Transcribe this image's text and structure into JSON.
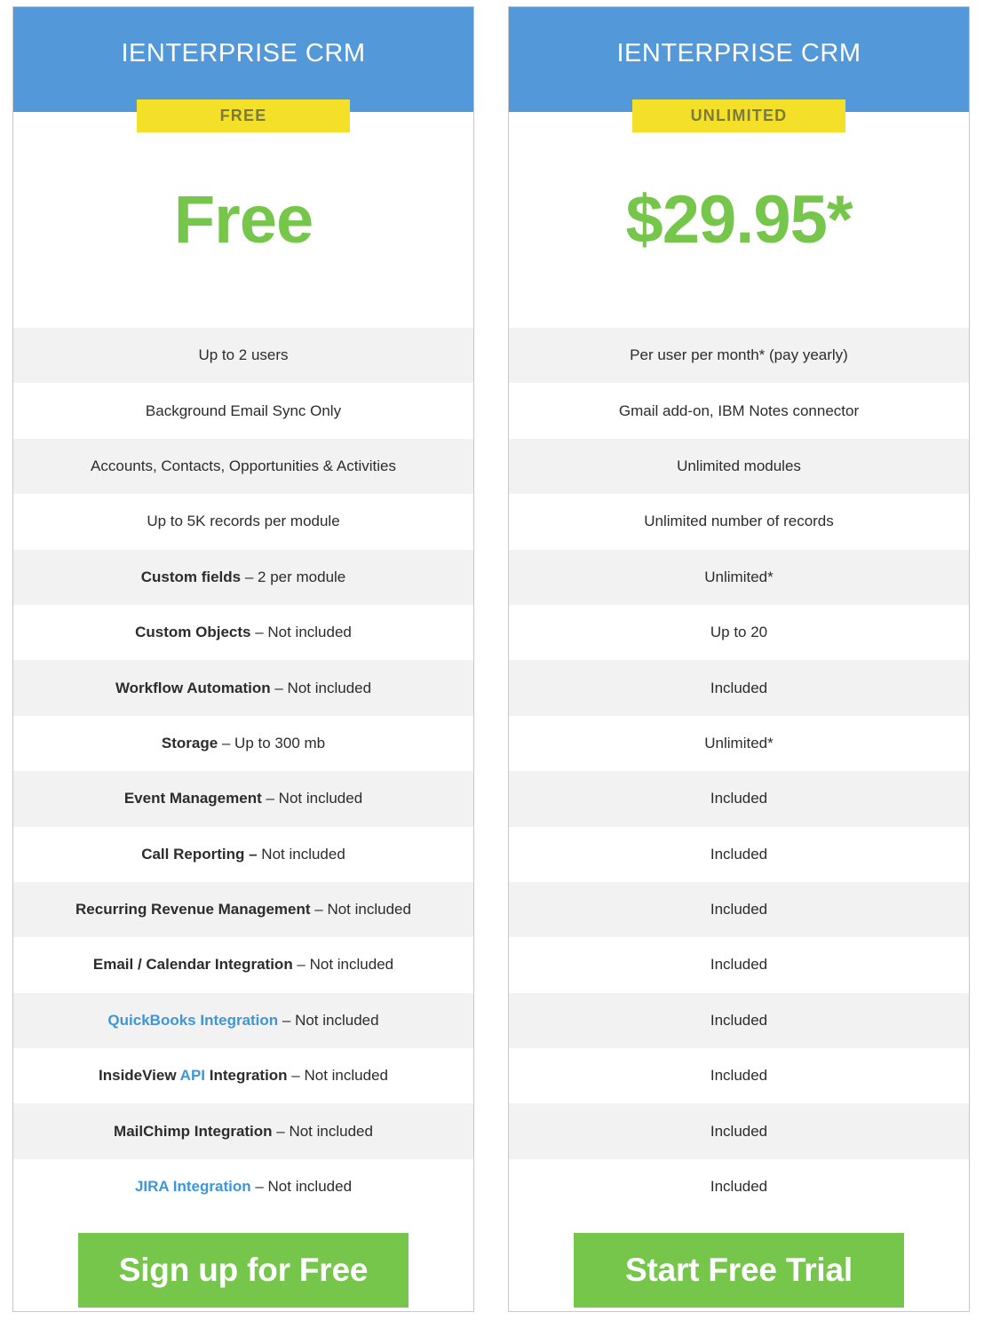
{
  "plans": [
    {
      "id": "free",
      "title": "IENTERPRISE CRM",
      "badge": "FREE",
      "price": "Free",
      "cta": "Sign up for Free",
      "features": [
        {
          "parts": [
            {
              "text": "Up to 2 users",
              "style": "plain"
            }
          ]
        },
        {
          "parts": [
            {
              "text": "Background Email Sync Only",
              "style": "plain"
            }
          ]
        },
        {
          "parts": [
            {
              "text": "Accounts, Contacts, Opportunities & Activities",
              "style": "plain"
            }
          ]
        },
        {
          "parts": [
            {
              "text": "Up to 5K records per module",
              "style": "plain"
            }
          ]
        },
        {
          "parts": [
            {
              "text": "Custom fields",
              "style": "bold"
            },
            {
              "text": " – 2 per module",
              "style": "plain"
            }
          ]
        },
        {
          "parts": [
            {
              "text": "Custom Objects",
              "style": "bold"
            },
            {
              "text": " – Not included",
              "style": "plain"
            }
          ]
        },
        {
          "parts": [
            {
              "text": "Workflow Automation",
              "style": "bold"
            },
            {
              "text": " – Not included",
              "style": "plain"
            }
          ]
        },
        {
          "parts": [
            {
              "text": "Storage",
              "style": "bold"
            },
            {
              "text": " – Up to 300 mb",
              "style": "plain"
            }
          ]
        },
        {
          "parts": [
            {
              "text": "Event Management",
              "style": "bold"
            },
            {
              "text": " – Not included",
              "style": "plain"
            }
          ]
        },
        {
          "parts": [
            {
              "text": "Call Reporting –",
              "style": "bold"
            },
            {
              "text": " Not included",
              "style": "plain"
            }
          ]
        },
        {
          "parts": [
            {
              "text": "Recurring Revenue Management",
              "style": "bold"
            },
            {
              "text": " – Not included",
              "style": "plain"
            }
          ]
        },
        {
          "parts": [
            {
              "text": "Email / Calendar Integration",
              "style": "bold"
            },
            {
              "text": " – Not included",
              "style": "plain"
            }
          ]
        },
        {
          "parts": [
            {
              "text": "QuickBooks Integration",
              "style": "link"
            },
            {
              "text": " – Not included",
              "style": "plain"
            }
          ]
        },
        {
          "parts": [
            {
              "text": "InsideView ",
              "style": "bold"
            },
            {
              "text": "API",
              "style": "link"
            },
            {
              "text": " Integration",
              "style": "bold"
            },
            {
              "text": " – Not included",
              "style": "plain"
            }
          ]
        },
        {
          "parts": [
            {
              "text": "MailChimp Integration",
              "style": "bold"
            },
            {
              "text": " – Not included",
              "style": "plain"
            }
          ]
        },
        {
          "parts": [
            {
              "text": "JIRA Integration",
              "style": "link"
            },
            {
              "text": " – Not included",
              "style": "plain"
            }
          ]
        }
      ]
    },
    {
      "id": "unlimited",
      "title": "IENTERPRISE CRM",
      "badge": "UNLIMITED",
      "price": "$29.95*",
      "cta": "Start Free Trial",
      "features": [
        {
          "parts": [
            {
              "text": "Per user per month* (pay yearly)",
              "style": "plain"
            }
          ]
        },
        {
          "parts": [
            {
              "text": "Gmail  add-on, IBM Notes connector",
              "style": "plain"
            }
          ]
        },
        {
          "parts": [
            {
              "text": "Unlimited modules",
              "style": "plain"
            }
          ]
        },
        {
          "parts": [
            {
              "text": "Unlimited number of records",
              "style": "plain"
            }
          ]
        },
        {
          "parts": [
            {
              "text": "Unlimited*",
              "style": "plain"
            }
          ]
        },
        {
          "parts": [
            {
              "text": "Up to 20",
              "style": "plain"
            }
          ]
        },
        {
          "parts": [
            {
              "text": "Included",
              "style": "plain"
            }
          ]
        },
        {
          "parts": [
            {
              "text": "Unlimited*",
              "style": "plain"
            }
          ]
        },
        {
          "parts": [
            {
              "text": "Included",
              "style": "plain"
            }
          ]
        },
        {
          "parts": [
            {
              "text": "Included",
              "style": "plain"
            }
          ]
        },
        {
          "parts": [
            {
              "text": "Included",
              "style": "plain"
            }
          ]
        },
        {
          "parts": [
            {
              "text": "Included",
              "style": "plain"
            }
          ]
        },
        {
          "parts": [
            {
              "text": "Included",
              "style": "plain"
            }
          ]
        },
        {
          "parts": [
            {
              "text": "Included",
              "style": "plain"
            }
          ]
        },
        {
          "parts": [
            {
              "text": "Included",
              "style": "plain"
            }
          ]
        },
        {
          "parts": [
            {
              "text": "Included",
              "style": "plain"
            }
          ]
        }
      ]
    }
  ],
  "colors": {
    "header_blue": "#5398d9",
    "badge_yellow": "#f5e029",
    "accent_green": "#76c64b",
    "link_blue": "#3d97d6",
    "stripe_gray": "#f2f2f2"
  }
}
